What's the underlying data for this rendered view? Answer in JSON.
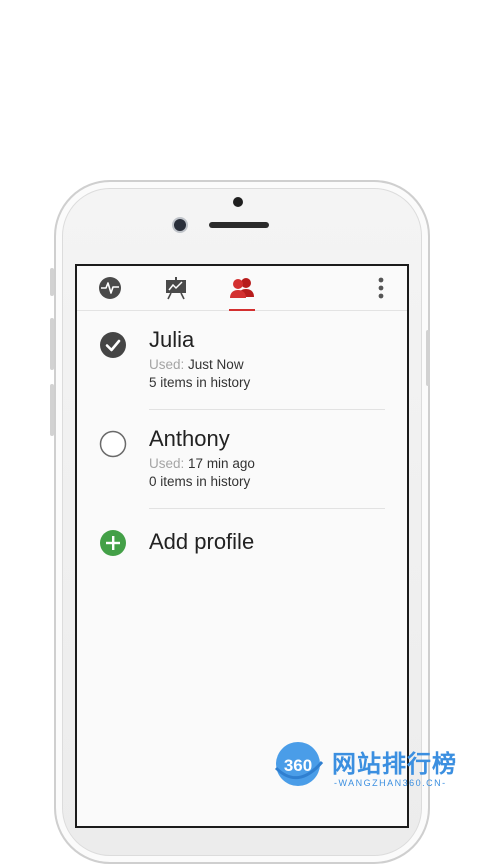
{
  "tabs": [
    {
      "name": "activity",
      "icon": "pulse-icon"
    },
    {
      "name": "chart",
      "icon": "presentation-chart-icon"
    },
    {
      "name": "profiles",
      "icon": "users-icon",
      "active": true
    }
  ],
  "menu_icon": "more-vert-icon",
  "accent_color": "#d32f2f",
  "profiles": [
    {
      "name": "Julia",
      "used_label": "Used:",
      "used_value": "Just Now",
      "history": "5 items in history",
      "selected": true
    },
    {
      "name": "Anthony",
      "used_label": "Used:",
      "used_value": "17 min ago",
      "history": "0 items in history",
      "selected": false
    }
  ],
  "add_profile": {
    "label": "Add profile",
    "color": "#43a047"
  },
  "watermark": {
    "chinese": "网站排行榜",
    "english": "-WANGZHAN360.CN-",
    "logo_text": "360"
  }
}
